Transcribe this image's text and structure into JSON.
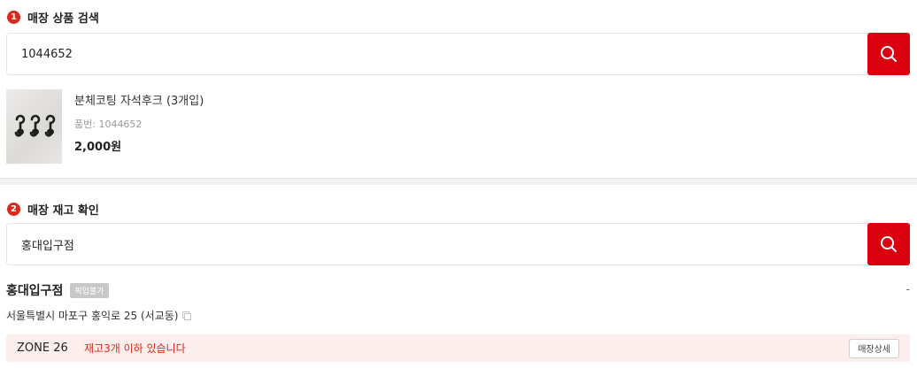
{
  "section1": {
    "number": "1",
    "title": "매장 상품 검색"
  },
  "product_search": {
    "value": "1044652"
  },
  "product": {
    "name": "분체코팅 자석후크 (3개입)",
    "code": "품번: 1044652",
    "price": "2,000원"
  },
  "section2": {
    "number": "2",
    "title": "매장 재고 확인"
  },
  "store_search": {
    "value": "홍대입구점"
  },
  "store": {
    "name": "홍대입구점",
    "badge": "픽업불가",
    "right_text": "-",
    "address": "서울특별시 마포구 홍익로 25 (서교동)"
  },
  "stock": {
    "zone": "ZONE 26",
    "message": "재고3개 이하 있습니다",
    "detail_label": "매장상세"
  },
  "colors": {
    "accent": "#da291c",
    "search_button": "#da0010",
    "stock_bg": "#fdeeee"
  },
  "icons": {
    "search": "search-icon",
    "copy": "copy-icon"
  }
}
